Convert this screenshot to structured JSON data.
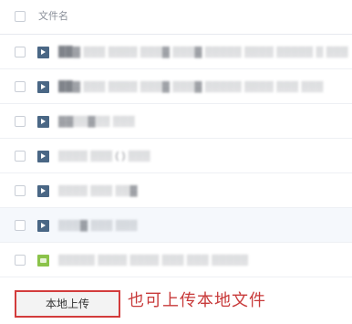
{
  "file_list": {
    "header_label": "文件名",
    "rows": [
      {
        "name": "██▓ ▒▒▒ ▒▒▒▒ ▒▒▒▓ ▒▒▒▓ ▒▒▒▒▒ ▒▒▒▒ ▒▒▒▒▒ ▒ ▒▒▒",
        "icon": "video-file-icon",
        "selected": false
      },
      {
        "name": "██▓ ▒▒▒ ▒▒▒▒ ▒▒▒▓ ▒▒▒▓ ▒▒▒▒▒ ▒▒▒▒ ▒▒▒ ▒▒▒",
        "icon": "video-file-icon",
        "selected": false
      },
      {
        "name": "▓▓▒▒▓▒▒ ▒▒▒",
        "icon": "video-file-icon",
        "selected": false
      },
      {
        "name": "▒▒▒▒ ▒▒▒ ( ) ▒▒▒",
        "icon": "video-file-icon",
        "selected": false
      },
      {
        "name": "▒▒▒▒ ▒▒▒ ▒▒▓",
        "icon": "video-file-icon",
        "selected": false
      },
      {
        "name": "▒▒▒▓ ▒▒▒ ▒▒▒",
        "icon": "video-file-icon",
        "selected": false
      },
      {
        "name": "▒▒▒▒▒ ▒▒▒▒ ▒▒▒▒ ▒▒▒ ▒▒▒ ▒▒▒▒▒",
        "icon": "document-file-icon",
        "selected": false
      }
    ]
  },
  "actions": {
    "upload_label": "本地上传"
  },
  "annotation": {
    "text": "也可上传本地文件",
    "color": "#c83a3a"
  },
  "colors": {
    "video_icon": "#4a6785",
    "doc_icon": "#8bc34a",
    "highlight_border": "#d33c3c"
  }
}
